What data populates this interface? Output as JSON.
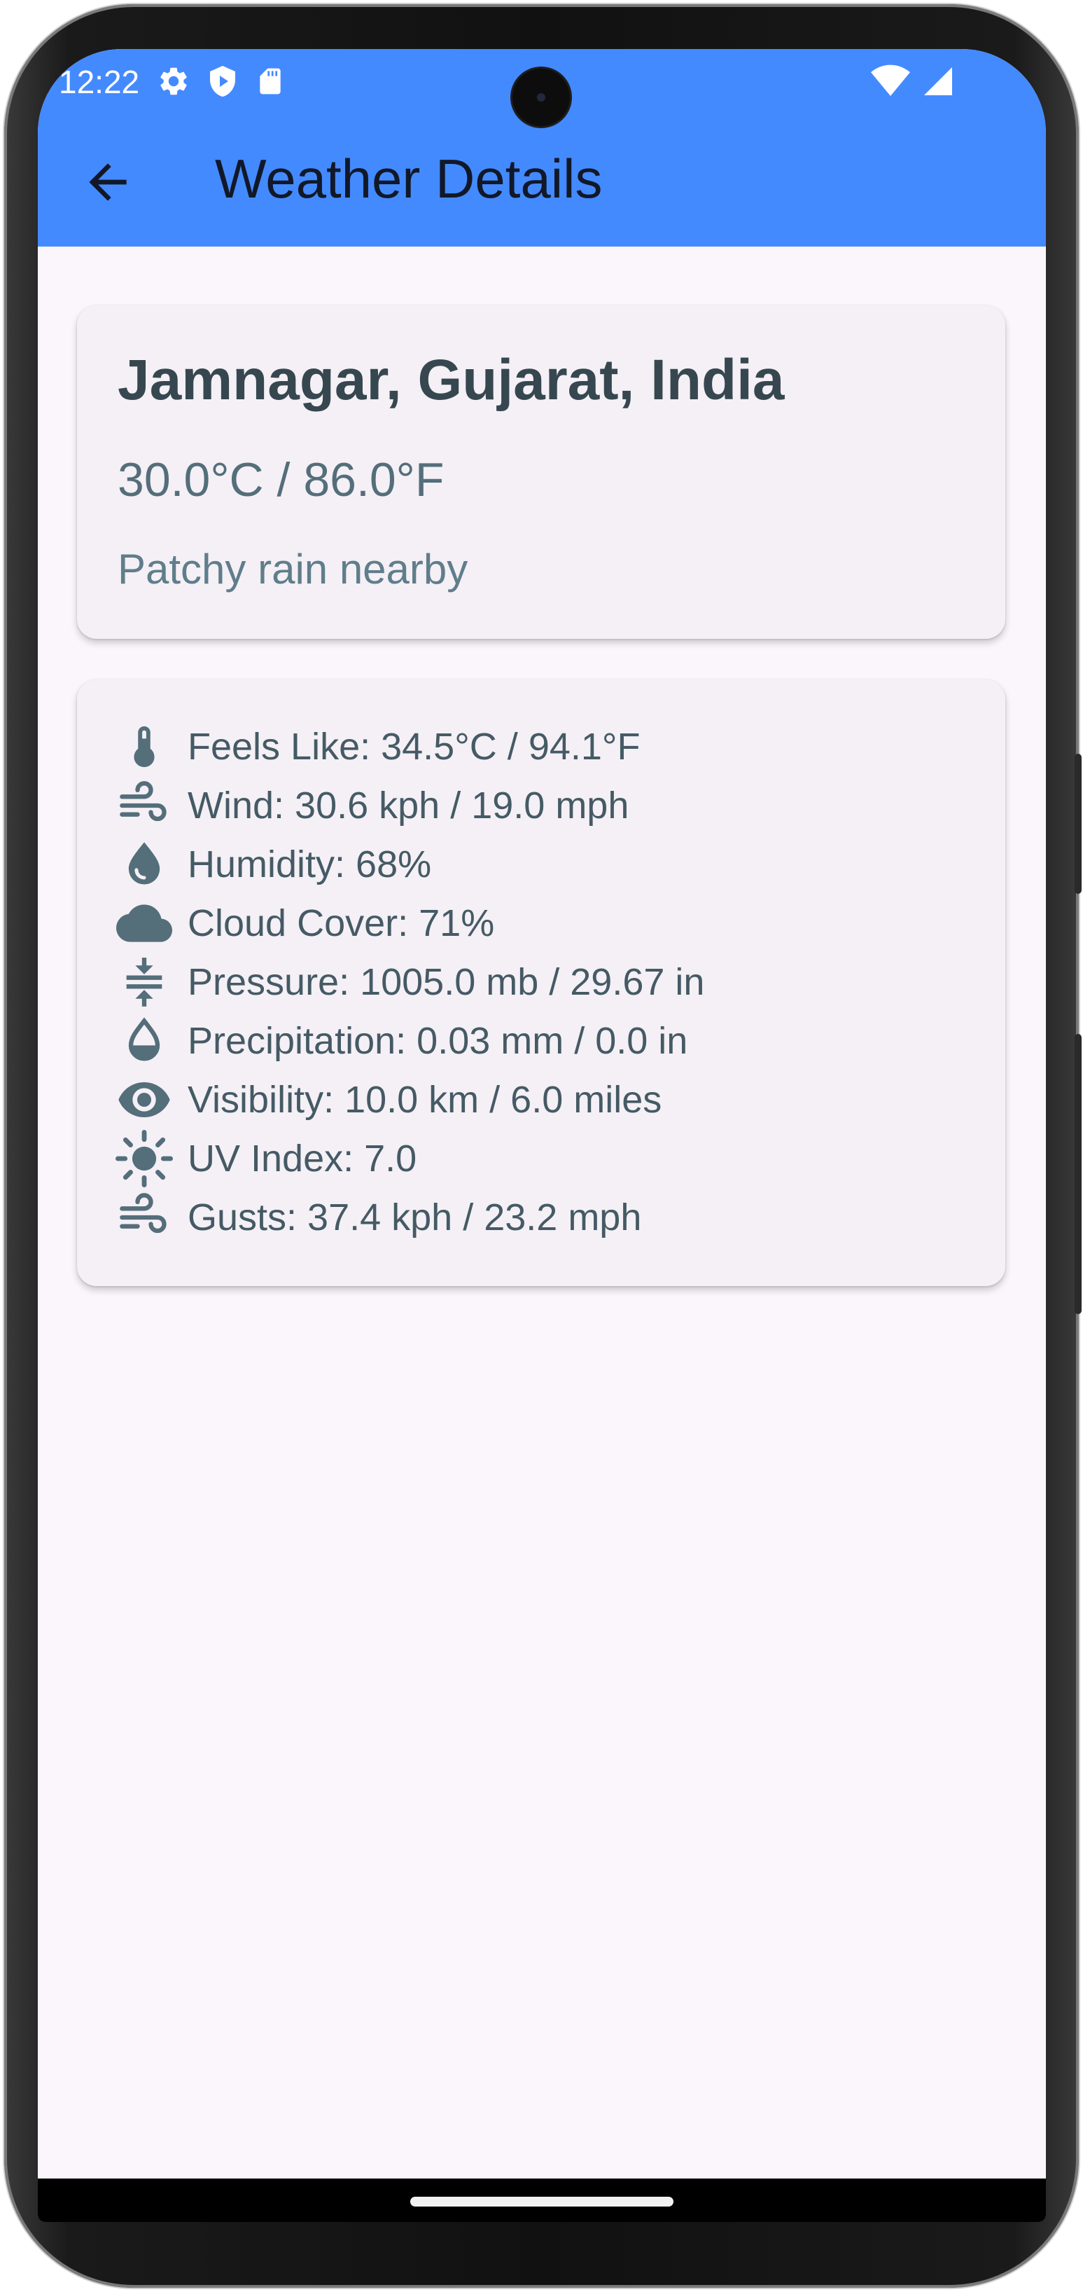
{
  "status_bar": {
    "time": "12:22",
    "left_icons": [
      "gear-icon",
      "shield-play-icon",
      "sd-card-icon"
    ],
    "right_icons": [
      "wifi-icon",
      "cell-signal-icon"
    ]
  },
  "app_bar": {
    "title": "Weather Details",
    "back_icon": "arrow-left-icon",
    "color": "#448aff"
  },
  "summary": {
    "location": "Jamnagar, Gujarat, India",
    "temperature": "30.0°C / 86.0°F",
    "condition": "Patchy rain nearby"
  },
  "details": [
    {
      "icon": "thermometer-icon",
      "text": "Feels Like: 34.5°C / 94.1°F"
    },
    {
      "icon": "wind-icon",
      "text": "Wind: 30.6 kph / 19.0 mph"
    },
    {
      "icon": "water-drop-icon",
      "text": "Humidity: 68%"
    },
    {
      "icon": "cloud-icon",
      "text": "Cloud Cover: 71%"
    },
    {
      "icon": "compress-icon",
      "text": "Pressure: 1005.0 mb / 29.67 in"
    },
    {
      "icon": "opacity-icon",
      "text": "Precipitation: 0.03 mm / 0.0 in"
    },
    {
      "icon": "eye-icon",
      "text": "Visibility: 10.0 km / 6.0 miles"
    },
    {
      "icon": "sun-icon",
      "text": "UV Index: 7.0"
    },
    {
      "icon": "wind-icon",
      "text": "Gusts: 37.4 kph / 23.2 mph"
    }
  ],
  "colors": {
    "icon": "#546e7a",
    "card": "#f4f0f6",
    "background": "#fbf6fc"
  }
}
